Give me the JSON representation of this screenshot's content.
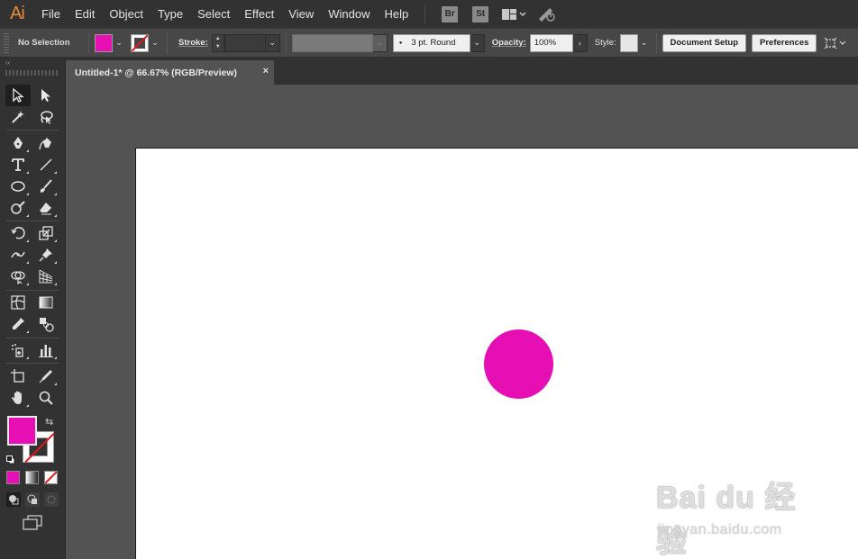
{
  "app": {
    "logo": "Ai"
  },
  "menu": {
    "items": [
      "File",
      "Edit",
      "Object",
      "Type",
      "Select",
      "Effect",
      "View",
      "Window",
      "Help"
    ]
  },
  "bridge_badges": {
    "br": "Br",
    "st": "St"
  },
  "controlbar": {
    "selection_status": "No Selection",
    "fill_color": "#e60fb4",
    "stroke_label": "Stroke:",
    "brush_value": "3 pt. Round",
    "opacity_label": "Opacity:",
    "opacity_value": "100%",
    "style_label": "Style:",
    "document_setup_label": "Document Setup",
    "preferences_label": "Preferences"
  },
  "document": {
    "tab_title": "Untitled-1* @ 66.67% (RGB/Preview)",
    "close_glyph": "×",
    "circle_color": "#e60fb4"
  },
  "tools": {
    "collapse_glyph": "‹‹",
    "fill_color": "#e60fb4",
    "stroke_none_color": "#e3161a"
  },
  "watermark": {
    "brand": "Bai du 经验",
    "url": "jingyan.baidu.com"
  }
}
